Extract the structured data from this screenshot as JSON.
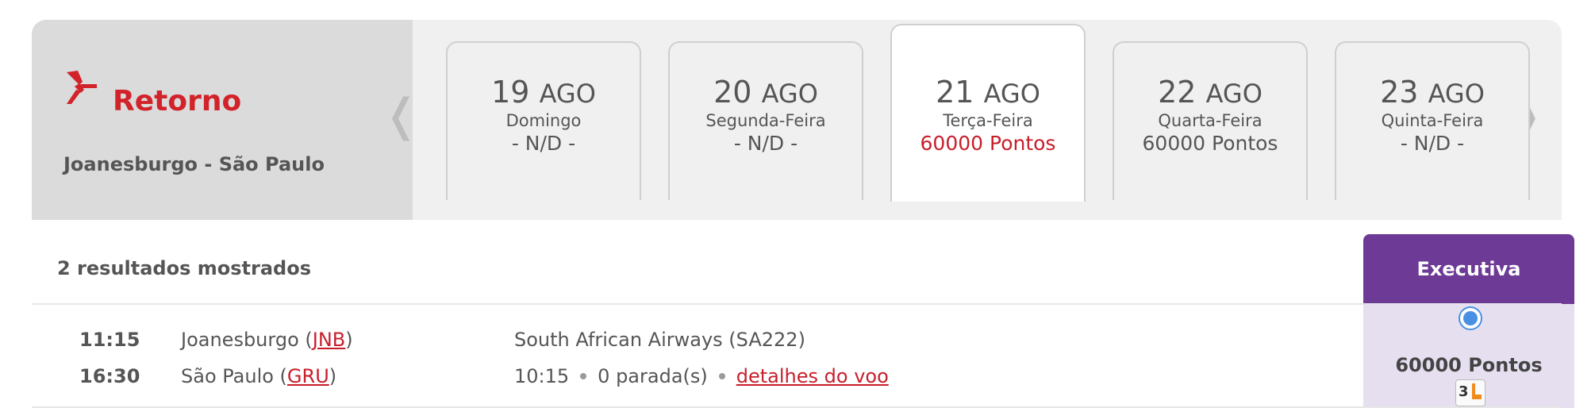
{
  "header": {
    "title": "Retorno",
    "route": "Joanesburgo - São Paulo",
    "prev_arrow": "❬",
    "next_arrow": "❭"
  },
  "date_tabs": [
    {
      "day": "19",
      "month": "AGO",
      "weekday": "Domingo",
      "price": "- N/D -",
      "selected": false
    },
    {
      "day": "20",
      "month": "AGO",
      "weekday": "Segunda-Feira",
      "price": "- N/D -",
      "selected": false
    },
    {
      "day": "21",
      "month": "AGO",
      "weekday": "Terça-Feira",
      "price": "60000 Pontos",
      "selected": true
    },
    {
      "day": "22",
      "month": "AGO",
      "weekday": "Quarta-Feira",
      "price": "60000 Pontos",
      "selected": false
    },
    {
      "day": "23",
      "month": "AGO",
      "weekday": "Quinta-Feira",
      "price": "- N/D -",
      "selected": false
    }
  ],
  "results": {
    "count_label": "2 resultados mostrados",
    "cabin_header": "Executiva"
  },
  "flight": {
    "departure_time": "11:15",
    "arrival_time": "16:30",
    "departure_city": "Joanesburgo",
    "departure_code": "JNB",
    "arrival_city": "São Paulo",
    "arrival_code": "GRU",
    "airline": "South African Airways (SA222)",
    "duration": "10:15",
    "stops": "0 parada(s)",
    "details_link": "detalhes do voo",
    "points": "60000 Pontos",
    "seats_left": "3",
    "radio_selected": true
  },
  "colors": {
    "brand_red": "#d2232a",
    "price_red": "#c81e2a",
    "cabin_purple": "#6d3a96",
    "cabin_cell": "#e6dff0",
    "radio_blue": "#4a90e2"
  }
}
